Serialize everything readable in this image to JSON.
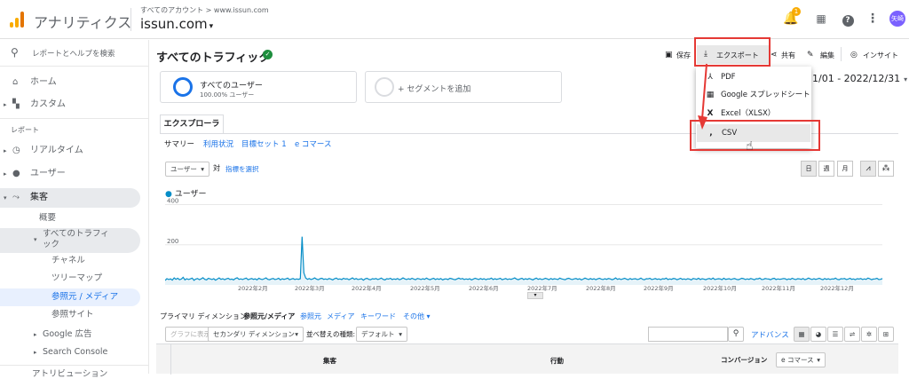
{
  "header": {
    "app_title": "アナリティクス",
    "account_path": "すべてのアカウント > www.issun.com",
    "property_name": "issun.com",
    "notification_count": "1",
    "avatar_text": "矢崎"
  },
  "sidebar": {
    "search_placeholder": "レポートとヘルプを検索",
    "home": "ホーム",
    "custom": "カスタム",
    "reports_heading": "レポート",
    "realtime": "リアルタイム",
    "audience": "ユーザー",
    "acquisition": "集客",
    "overview": "概要",
    "all_traffic": "すべてのトラフィック",
    "channels": "チャネル",
    "treemaps": "ツリーマップ",
    "source_medium": "参照元 / メディア",
    "referrals": "参照サイト",
    "google_ads": "Google 広告",
    "search_console": "Search Console",
    "attribution": "アトリビューション"
  },
  "page": {
    "title": "すべてのトラフィック",
    "save": "保存",
    "export": "エクスポート",
    "share": "共有",
    "edit": "編集",
    "insight": "インサイト",
    "date_range": "1/01 - 2022/12/31"
  },
  "segments": {
    "all_users": "すべてのユーザー",
    "all_users_pct": "100.00% ユーザー",
    "add_segment": "+ セグメントを追加"
  },
  "explorer": {
    "tab": "エクスプローラ",
    "subtabs": [
      "サマリー",
      "利用状況",
      "目標セット 1",
      "e コマース"
    ],
    "metric_select": "ユーザー",
    "vs": "対",
    "select_metric": "指標を選択",
    "granularity": [
      "日",
      "週",
      "月"
    ]
  },
  "export_menu": {
    "items": [
      "PDF",
      "Google スプレッドシート",
      "Excel（XLSX）",
      "CSV"
    ]
  },
  "chart_data": {
    "type": "line",
    "series": [
      {
        "name": "ユーザー",
        "values": [
          22,
          31,
          27,
          30,
          24,
          35,
          28,
          33,
          26,
          29,
          38,
          25,
          31,
          27,
          30,
          34,
          23,
          29,
          32,
          26,
          30,
          36,
          28,
          25,
          33,
          30,
          27,
          31,
          24,
          29,
          35,
          28,
          31,
          26,
          30,
          33,
          27,
          29,
          25,
          32,
          36,
          28,
          30,
          27,
          31,
          34,
          26,
          29,
          32,
          28,
          30,
          25,
          33,
          29,
          27,
          31,
          35,
          28,
          26,
          30,
          32,
          27,
          29,
          33,
          25,
          31,
          28,
          30,
          34,
          26,
          29,
          32,
          27,
          30,
          28,
          31,
          240,
          60,
          34,
          28,
          32,
          27,
          30,
          35,
          29,
          26,
          31,
          33,
          28,
          30,
          27,
          32,
          29,
          25,
          31,
          34,
          28,
          30,
          27,
          33,
          29,
          31,
          26,
          30,
          35,
          28,
          32,
          27,
          29,
          31,
          24,
          30,
          33,
          28,
          26,
          31,
          29,
          32,
          27,
          30,
          34,
          28,
          25,
          31,
          29,
          33,
          27,
          30,
          28,
          32,
          26,
          29,
          35,
          30,
          27,
          31,
          28,
          33,
          29,
          26,
          32,
          30,
          27,
          31,
          28,
          34,
          29,
          26,
          30,
          33,
          27,
          31,
          28,
          32,
          25,
          29,
          30,
          27,
          33,
          31,
          28,
          26,
          30,
          34,
          29,
          32,
          27,
          30,
          28,
          31,
          25,
          29,
          33,
          30,
          27,
          32,
          28,
          31,
          26,
          30,
          29,
          34,
          27,
          31,
          28,
          30,
          33,
          26,
          29,
          32,
          27,
          30,
          28,
          31,
          35,
          29,
          26,
          30,
          33,
          27,
          31,
          28,
          32,
          29,
          25,
          30,
          34,
          28,
          31,
          27,
          29,
          33,
          30,
          26,
          32,
          28,
          31,
          29,
          27,
          34,
          30,
          28,
          26,
          31,
          33,
          29,
          27,
          30,
          32,
          28,
          31,
          25,
          29,
          34,
          30,
          27,
          32,
          28,
          31,
          26,
          30,
          33,
          29,
          27,
          31,
          28,
          32,
          30,
          26,
          29,
          35,
          28,
          31,
          27,
          30,
          33,
          29,
          26,
          32,
          28,
          30,
          31,
          27,
          29,
          34,
          28,
          26,
          31,
          30,
          33,
          27,
          29,
          32,
          28,
          30,
          26,
          31,
          29,
          34,
          27,
          30,
          28,
          32,
          31,
          26,
          29,
          33,
          28,
          30,
          27,
          31,
          29,
          25,
          32,
          30,
          28,
          33,
          27,
          31,
          29,
          26,
          30,
          32,
          28,
          34,
          27,
          29,
          31,
          30,
          26,
          33,
          28,
          29,
          31,
          27,
          30,
          32,
          28,
          26,
          29,
          33,
          31,
          27,
          30,
          28,
          32,
          29,
          26,
          31,
          30,
          34,
          27,
          28,
          32,
          30,
          29,
          26,
          31,
          33,
          27,
          30,
          28,
          29,
          32,
          31,
          26,
          30,
          28,
          33,
          29,
          27,
          31,
          30,
          28,
          32,
          26,
          29,
          34,
          30,
          27,
          31,
          28,
          30,
          33,
          29,
          26,
          32,
          28,
          31,
          27,
          30,
          29,
          34,
          28,
          26,
          31,
          30,
          32,
          27,
          29,
          33,
          28,
          30,
          26,
          31,
          29,
          32,
          27,
          30,
          28,
          34,
          31,
          26,
          29,
          30,
          33,
          27,
          28,
          32
        ]
      }
    ],
    "y_ticks": [
      "400",
      "200"
    ],
    "ylim": [
      0,
      420
    ],
    "x_labels": [
      "2022年2月",
      "2022年3月",
      "2022年4月",
      "2022年5月",
      "2022年6月",
      "2022年7月",
      "2022年8月",
      "2022年9月",
      "2022年10月",
      "2022年11月",
      "2022年12月"
    ]
  },
  "dimensions": {
    "primary_label": "プライマリ ディメンション:",
    "active": "参照元/メディア",
    "others": [
      "参照元",
      "メディア",
      "キーワード",
      "その他"
    ]
  },
  "table_controls": {
    "plot_rows": "グラフに表示",
    "secondary_dim": "セカンダリ ディメンション",
    "sort_type_label": "並べ替えの種類:",
    "sort_type": "デフォルト",
    "advanced": "アドバンス",
    "conversion_label": "コンバージョン",
    "conversion_select": "e コマース"
  },
  "table_head": {
    "acquisition": "集客",
    "behavior": "行動"
  }
}
